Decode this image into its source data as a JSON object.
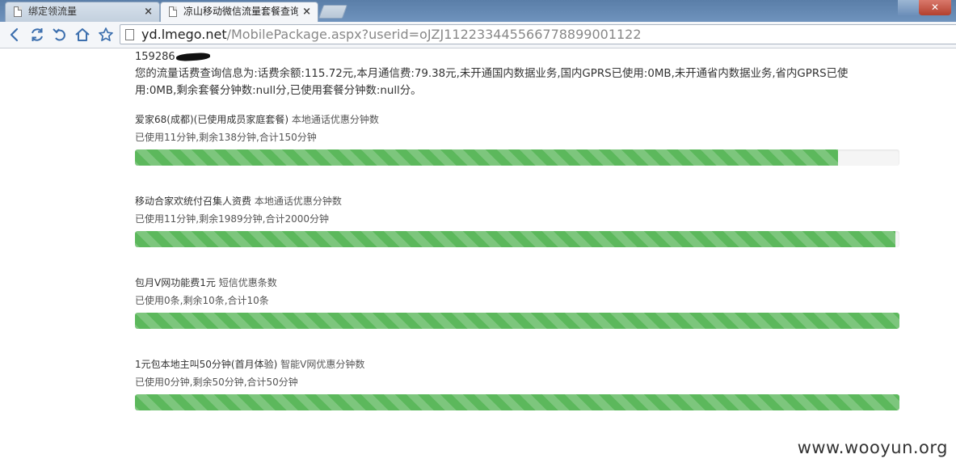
{
  "browser": {
    "tabs": [
      {
        "title": "绑定领流量",
        "close": "×"
      },
      {
        "title": "凉山移动微信流量套餐查询",
        "close": "×"
      }
    ],
    "url_host": "yd.lmego.net",
    "url_path": "/MobilePackage.aspx?userid=oJZJ11223344556677889900112​2"
  },
  "page": {
    "phone_prefix": "159286",
    "summary": "您的流量话费查询信息为:话费余额:115.72元,本月通信费:79.38元,未开通国内数据业务,国内GPRS已使用:0MB,未开通省内数据业务,省内GPRS已使用:0MB,剩余套餐分钟数:null分,已使用套餐分钟数:null分。",
    "packages": [
      {
        "name": "爱家68(成都)(已使用成员家庭套餐)",
        "type": "本地通话优惠分钟数",
        "usage": "已使用11分钟,剩余138分钟,合计150分钟",
        "fill_fraction": 0.92
      },
      {
        "name": "移动合家欢统付召集人资费",
        "type": "本地通话优惠分钟数",
        "usage": "已使用11分钟,剩余1989分钟,合计2000分钟",
        "fill_fraction": 0.995
      },
      {
        "name": "包月V网功能费1元",
        "type": "短信优惠条数",
        "usage": "已使用0条,剩余10条,合计10条",
        "fill_fraction": 1.0
      },
      {
        "name": "1元包本地主叫50分钟(首月体验)",
        "type": "智能V网优惠分钟数",
        "usage": "已使用0分钟,剩余50分钟,合计50分钟",
        "fill_fraction": 1.0
      }
    ]
  },
  "watermark": "www.wooyun.org",
  "colors": {
    "progress_green": "#5cb85c",
    "progress_track": "#f5f5f5",
    "nav_blue": "#3c6fae"
  }
}
